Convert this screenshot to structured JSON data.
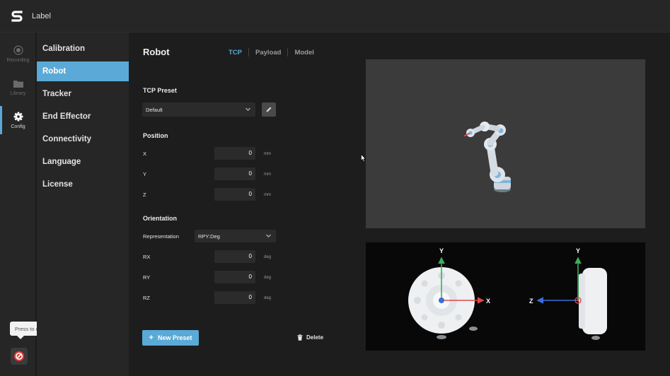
{
  "app": {
    "title": "Label"
  },
  "rail": {
    "items": [
      {
        "label": "Recording",
        "icon": "record-icon"
      },
      {
        "label": "Library",
        "icon": "folder-icon"
      },
      {
        "label": "Config",
        "icon": "gear-icon"
      }
    ],
    "tooltip": "Press to connect the robot"
  },
  "categories": [
    "Calibration",
    "Robot",
    "Tracker",
    "End Effector",
    "Connectivity",
    "Language",
    "License"
  ],
  "page": {
    "title": "Robot",
    "tabs": [
      "TCP",
      "Payload",
      "Model"
    ]
  },
  "tcp_preset": {
    "label": "TCP Preset",
    "value": "Default"
  },
  "position": {
    "label": "Position",
    "fields": [
      {
        "name": "X",
        "value": "0",
        "unit": "mm"
      },
      {
        "name": "Y",
        "value": "0",
        "unit": "mm"
      },
      {
        "name": "Z",
        "value": "0",
        "unit": "mm"
      }
    ]
  },
  "orientation": {
    "label": "Orientation",
    "representation_label": "Representation",
    "representation_value": "RPY:Deg",
    "fields": [
      {
        "name": "RX",
        "value": "0",
        "unit": "deg"
      },
      {
        "name": "RY",
        "value": "0",
        "unit": "deg"
      },
      {
        "name": "RZ",
        "value": "0",
        "unit": "deg"
      }
    ]
  },
  "actions": {
    "new_preset": "New Preset",
    "delete": "Delete"
  },
  "axes": {
    "front_y": "Y",
    "front_x": "X",
    "side_y": "Y",
    "side_z": "Z"
  },
  "colors": {
    "accent": "#5aa9d6",
    "x_axis": "#e04848",
    "y_axis": "#3fae5a",
    "z_axis": "#3a6fd8"
  }
}
